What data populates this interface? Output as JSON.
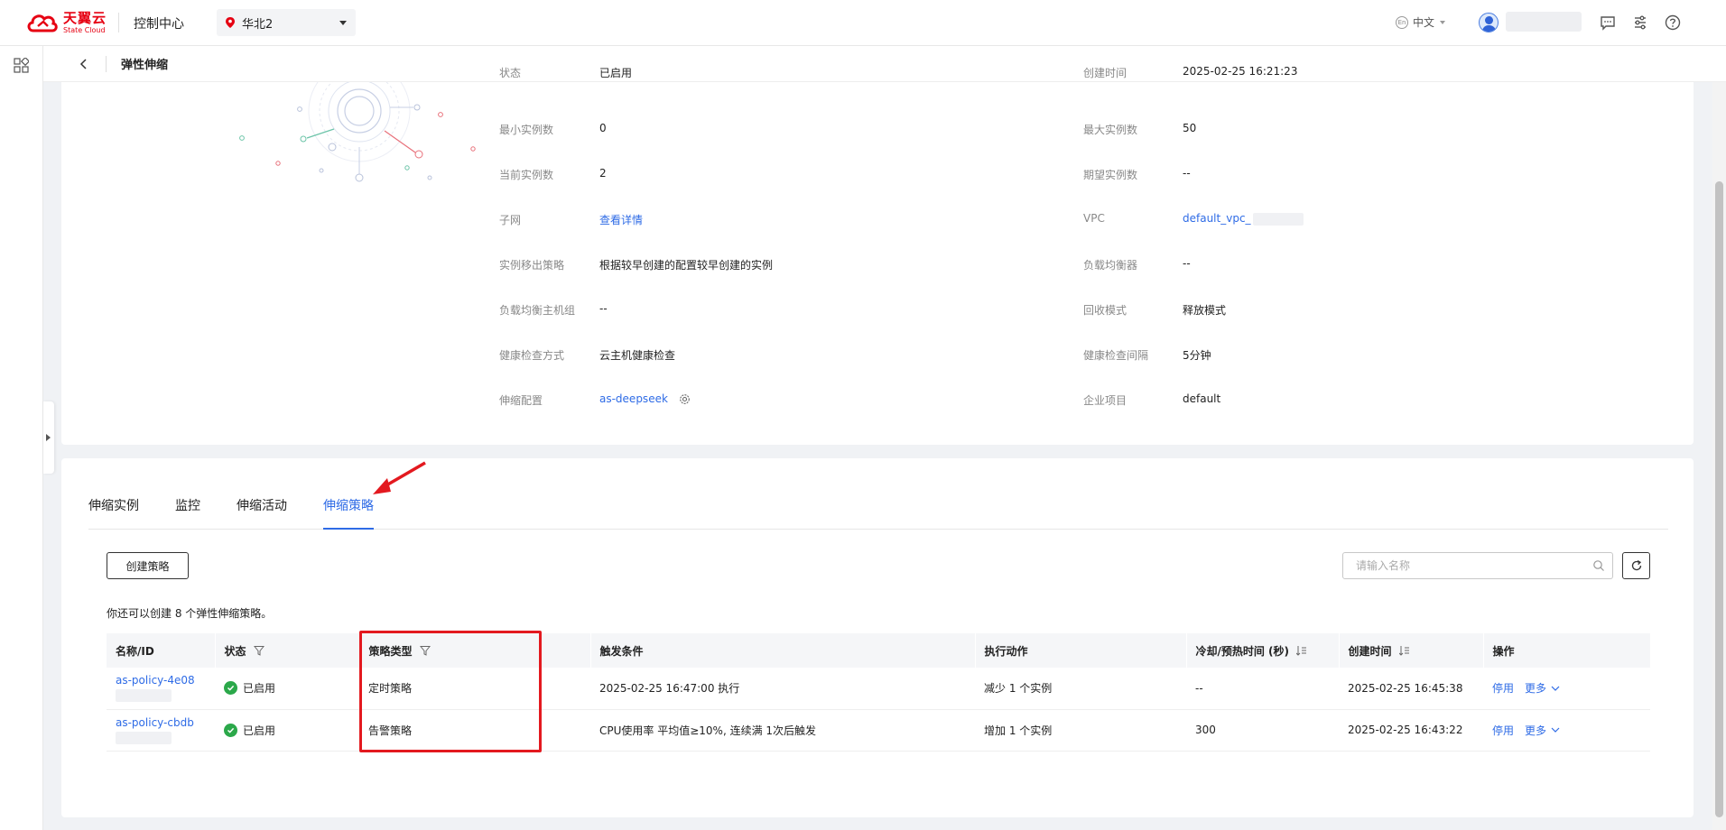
{
  "header": {
    "logo_cn": "天翼云",
    "logo_en": "State Cloud",
    "console": "控制中心",
    "region": "华北2",
    "language": "中文",
    "icons": [
      "message-icon",
      "settings-sliders-icon",
      "help-icon"
    ]
  },
  "breadcrumb": {
    "title": "弹性伸缩"
  },
  "details": {
    "left": [
      {
        "label": "状态",
        "value": "已启用"
      },
      {
        "label": "最小实例数",
        "value": "0"
      },
      {
        "label": "当前实例数",
        "value": "2"
      },
      {
        "label": "子网",
        "value": "查看详情",
        "link": true
      },
      {
        "label": "实例移出策略",
        "value": "根据较早创建的配置较早创建的实例"
      },
      {
        "label": "负载均衡主机组",
        "value": "--"
      },
      {
        "label": "健康检查方式",
        "value": "云主机健康检查"
      },
      {
        "label": "伸缩配置",
        "value": "as-deepseek",
        "link": true
      }
    ],
    "right": [
      {
        "label": "创建时间",
        "value": "2025-02-25 16:21:23"
      },
      {
        "label": "最大实例数",
        "value": "50"
      },
      {
        "label": "期望实例数",
        "value": "--"
      },
      {
        "label": "VPC",
        "value": "default_vpc_",
        "link": true
      },
      {
        "label": "负载均衡器",
        "value": "--"
      },
      {
        "label": "回收模式",
        "value": "释放模式"
      },
      {
        "label": "健康检查间隔",
        "value": "5分钟"
      },
      {
        "label": "企业项目",
        "value": "default"
      }
    ]
  },
  "tabs": [
    "伸缩实例",
    "监控",
    "伸缩活动",
    "伸缩策略"
  ],
  "active_tab": "伸缩策略",
  "toolbar": {
    "create_label": "创建策略",
    "search_placeholder": "请输入名称"
  },
  "quota_text": "你还可以创建 8 个弹性伸缩策略。",
  "table": {
    "columns": [
      "名称/ID",
      "状态",
      "策略类型",
      "触发条件",
      "执行动作",
      "冷却/预热时间 (秒)",
      "创建时间",
      "操作"
    ],
    "rows": [
      {
        "name": "as-policy-4e08",
        "status": "已启用",
        "type": "定时策略",
        "trigger": "2025-02-25 16:47:00 执行",
        "action": "减少 1 个实例",
        "cooldown": "--",
        "created": "2025-02-25 16:45:38",
        "op_disable": "停用",
        "op_more": "更多"
      },
      {
        "name": "as-policy-cbdb",
        "status": "已启用",
        "type": "告警策略",
        "trigger": "CPU使用率 平均值≥10%, 连续满 1次后触发",
        "action": "增加 1 个实例",
        "cooldown": "300",
        "created": "2025-02-25 16:43:22",
        "op_disable": "停用",
        "op_more": "更多"
      }
    ]
  },
  "colors": {
    "accent": "#2e6be6",
    "brand": "#e60012",
    "success": "#2ba84a",
    "annotation": "#e3191f"
  }
}
